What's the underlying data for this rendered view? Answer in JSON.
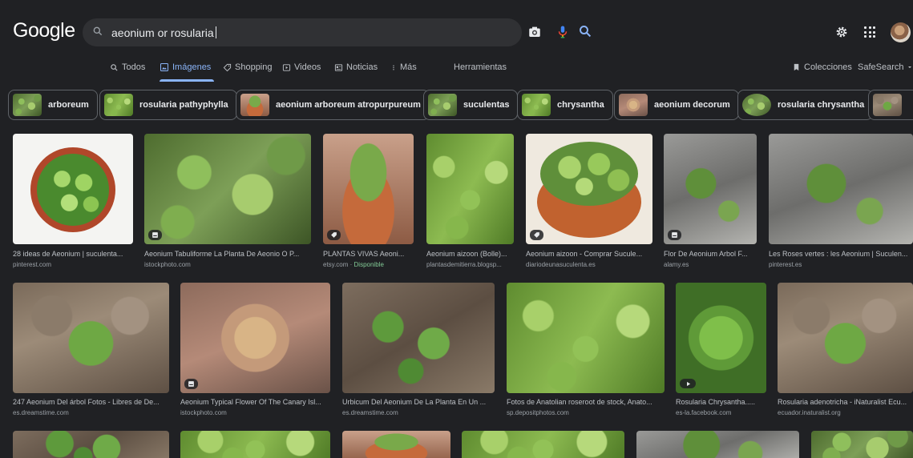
{
  "header": {
    "logo": "Google",
    "search_value": "aeonium or rosularia"
  },
  "tabs": {
    "todos": "Todos",
    "imagenes": "Imágenes",
    "shopping": "Shopping",
    "videos": "Videos",
    "noticias": "Noticias",
    "mas": "Más",
    "herramientas": "Herramientas",
    "colecciones": "Colecciones",
    "safesearch": "SafeSearch"
  },
  "chips": [
    {
      "label": "arboreum"
    },
    {
      "label": "rosularia pathyphylla"
    },
    {
      "label": "aeonium arboreum atropurpureum"
    },
    {
      "label": "suculentas"
    },
    {
      "label": "chrysantha"
    },
    {
      "label": "aeonium decorum"
    },
    {
      "label": "rosularia chrysantha"
    }
  ],
  "results_row1": [
    {
      "caption": "28 ideas de Aeonium | suculenta...",
      "source": "pinterest.com"
    },
    {
      "caption": "Aeonium Tabuliforme La Planta De Aeonio O P...",
      "source": "istockphoto.com"
    },
    {
      "caption": "PLANTAS VIVAS Aeoni...",
      "source": "etsy.com",
      "availability": "Disponible"
    },
    {
      "caption": "Aeonium aizoon (Bolle)...",
      "source": "plantasdemitierra.blogsp..."
    },
    {
      "caption": "Aeonium aizoon - Comprar Sucule...",
      "source": "diariodeunasuculenta.es"
    },
    {
      "caption": "Flor De Aeonium Arbol F...",
      "source": "alamy.es"
    },
    {
      "caption": "Les Roses vertes : les Aeonium | Suculen...",
      "source": "pinterest.es"
    }
  ],
  "results_row2": [
    {
      "caption": "247 Aeonium Del árbol Fotos - Libres de De...",
      "source": "es.dreamstime.com"
    },
    {
      "caption": "Aeonium Typical Flower Of The Canary Isl...",
      "source": "istockphoto.com"
    },
    {
      "caption": "Urbicum Del Aeonium De La Planta En Un ...",
      "source": "es.dreamstime.com"
    },
    {
      "caption": "Fotos de Anatolian roseroot de stock, Anato...",
      "source": "sp.depositphotos.com"
    },
    {
      "caption": "Rosularia Chrysantha.....",
      "source": "es-la.facebook.com"
    },
    {
      "caption": "Rosularia adenotricha - iNaturalist Ecu...",
      "source": "ecuador.inaturalist.org"
    }
  ],
  "colors": {
    "background": "#202124",
    "accent": "#8ab4f8",
    "text": "#e8eaed",
    "muted": "#9aa0a6",
    "available": "#81c995"
  }
}
